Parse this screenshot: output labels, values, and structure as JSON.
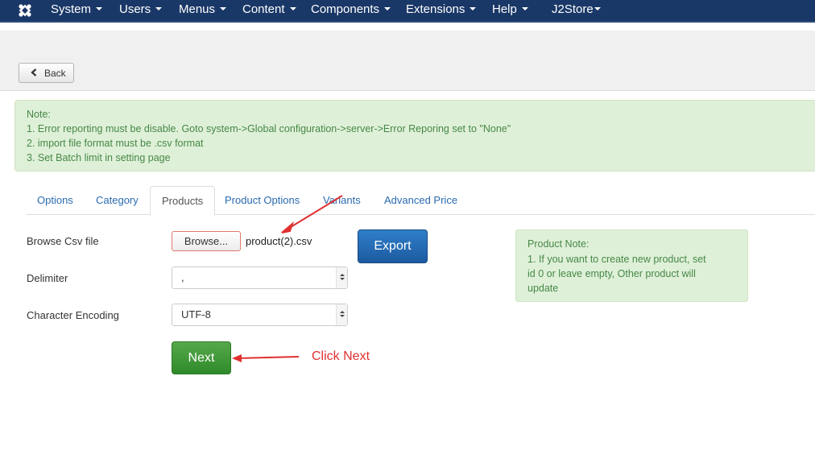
{
  "navbar": {
    "logo_icon": "joomla-logo-icon",
    "items": [
      {
        "label": "System"
      },
      {
        "label": "Users"
      },
      {
        "label": "Menus"
      },
      {
        "label": "Content"
      },
      {
        "label": "Components"
      },
      {
        "label": "Extensions"
      },
      {
        "label": "Help"
      },
      {
        "label": "J2Store"
      }
    ]
  },
  "toolbar": {
    "back_label": "Back",
    "back_icon": "chevron-left-icon"
  },
  "note": {
    "title": "Note:",
    "lines": [
      "1. Error reporting must be disable. Goto system->Global configuration->server->Error Reporing set to \"None\"",
      "2. import file format must be .csv format",
      "3. Set Batch limit in setting page"
    ]
  },
  "tabs": {
    "items": [
      {
        "label": "Options"
      },
      {
        "label": "Category"
      },
      {
        "label": "Products"
      },
      {
        "label": "Product Options"
      },
      {
        "label": "Variants"
      },
      {
        "label": "Advanced Price"
      }
    ],
    "active": "Products"
  },
  "form": {
    "browse_label": "Browse Csv file",
    "browse_button": "Browse...",
    "file_name": "product(2).csv",
    "export_button": "Export",
    "delimiter_label": "Delimiter",
    "delimiter_value": ",",
    "encoding_label": "Character Encoding",
    "encoding_value": "UTF-8",
    "next_button": "Next"
  },
  "product_note": {
    "title": "Product Note:",
    "lines": [
      "1. If you want to create new product, set",
      "id 0 or leave empty, Other product will",
      "update"
    ]
  },
  "annotation": {
    "click_next": "Click Next",
    "color": "#e03030"
  },
  "colors": {
    "navbar": "#1a3867",
    "alert_bg": "#dff0d8",
    "alert_text": "#468847",
    "export_btn": "#1d5aa0",
    "next_btn": "#2f8a2a",
    "link": "#2a6ab0"
  }
}
